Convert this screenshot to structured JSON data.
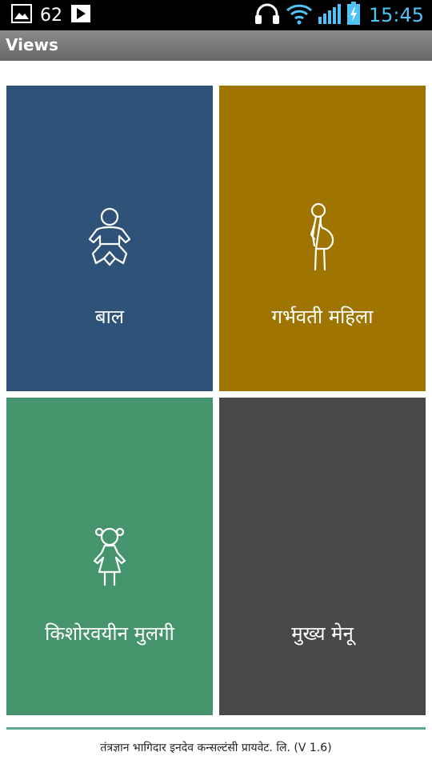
{
  "status_bar": {
    "count": "62",
    "time": "15:45"
  },
  "action_bar": {
    "title": "Views"
  },
  "tiles": [
    {
      "label": "बाल",
      "icon": "baby-icon",
      "color": "#2f5378"
    },
    {
      "label": "गर्भवती महिला",
      "icon": "pregnant-woman-icon",
      "color": "#a07400"
    },
    {
      "label": "किशोरवयीन मुलगी",
      "icon": "girl-icon",
      "color": "#46946b"
    },
    {
      "label": "मुख्य मेनू",
      "icon": "",
      "color": "#484848"
    }
  ],
  "footer": {
    "text": "तंत्रज्ञान भागिदार इनदेव कन्सल्टंसी प्रायवेट. लि. (V 1.6)"
  },
  "colors": {
    "status_time": "#4fc3f7",
    "divider": "#5aa88a"
  }
}
